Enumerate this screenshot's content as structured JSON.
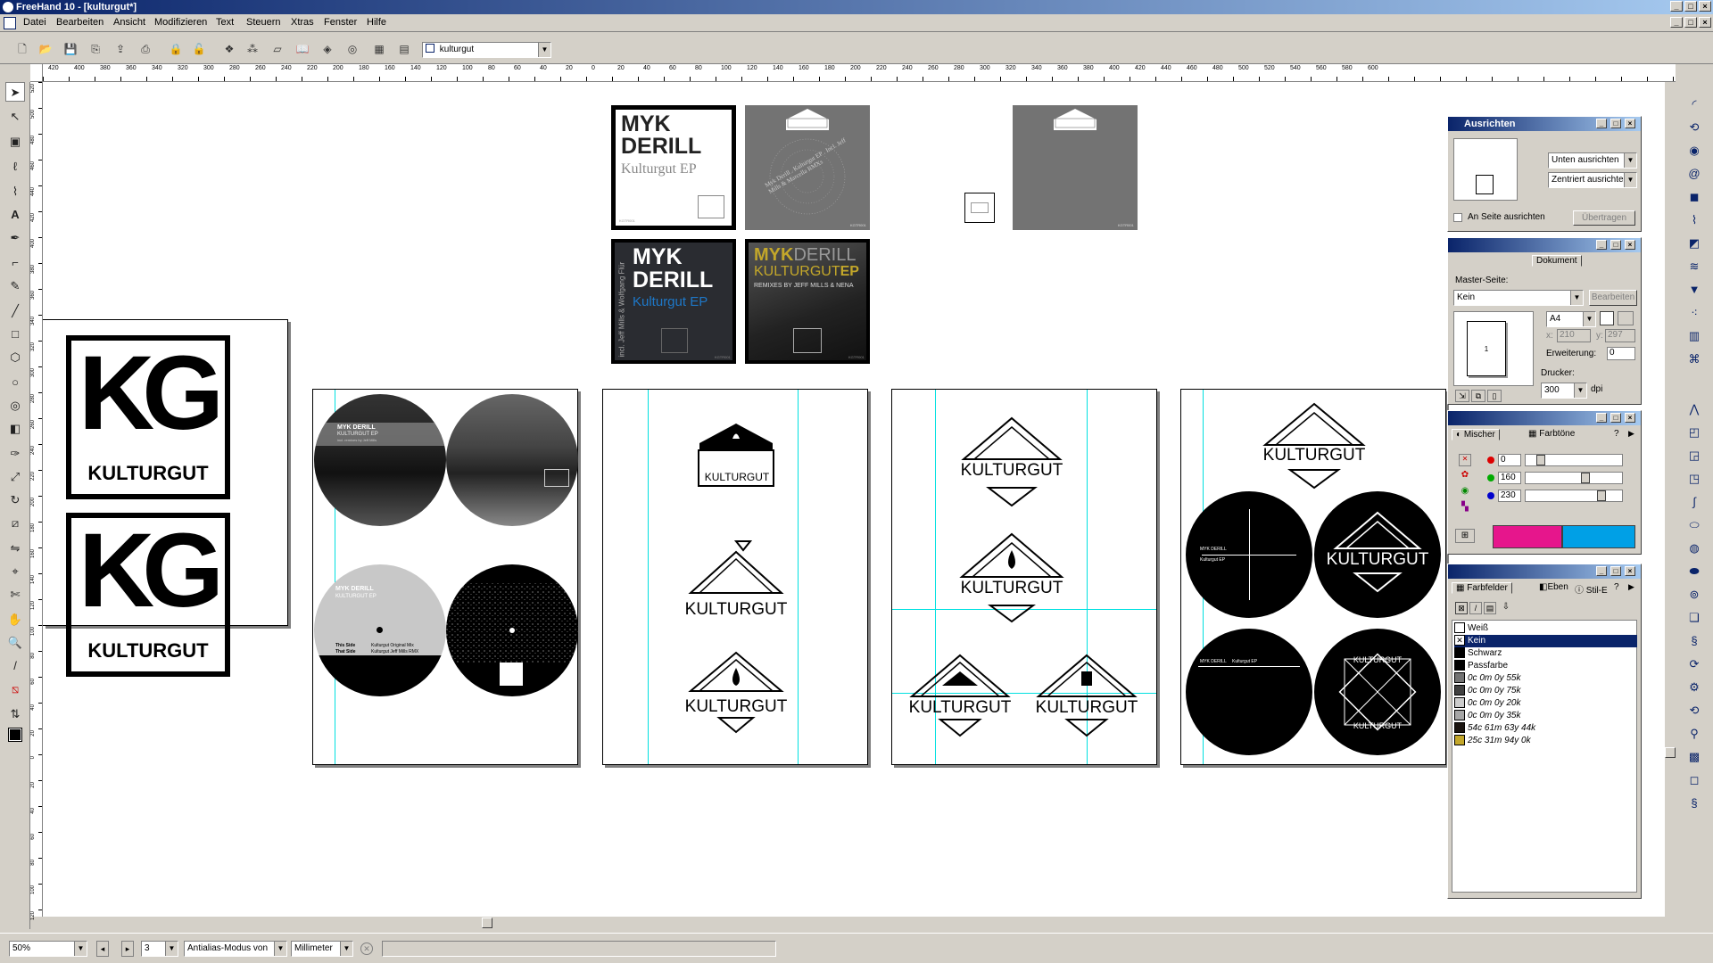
{
  "window": {
    "title": "FreeHand 10 - [kulturgut*]"
  },
  "menu": [
    "Datei",
    "Bearbeiten",
    "Ansicht",
    "Modifizieren",
    "Text",
    "Steuern",
    "Xtras",
    "Fenster",
    "Hilfe"
  ],
  "toolbar": {
    "document_select": "kulturgut"
  },
  "hruler": {
    "labels": [
      "420",
      "400",
      "380",
      "360",
      "340",
      "320",
      "300",
      "280",
      "260",
      "240",
      "220",
      "200",
      "180",
      "160",
      "140",
      "120",
      "100",
      "80",
      "60",
      "40",
      "20",
      "0",
      "20",
      "40",
      "60",
      "80",
      "100",
      "120",
      "140",
      "160",
      "180",
      "200",
      "220",
      "240",
      "260",
      "280",
      "300",
      "320",
      "340",
      "360",
      "380",
      "400",
      "420",
      "440",
      "460",
      "480",
      "500",
      "520",
      "540",
      "560",
      "580",
      "600"
    ]
  },
  "vruler": {
    "labels": [
      "520",
      "500",
      "480",
      "460",
      "440",
      "420",
      "400",
      "380",
      "360",
      "340",
      "320",
      "300",
      "280",
      "260",
      "240",
      "220",
      "200",
      "180",
      "160",
      "140",
      "120",
      "100",
      "80",
      "60",
      "40",
      "20",
      "0",
      "20",
      "40",
      "60",
      "80",
      "100",
      "120"
    ]
  },
  "artwork": {
    "cover1": {
      "line1": "MYK",
      "line2": "DERILL",
      "line3": "Kulturgut EP",
      "cat": "KGTR001"
    },
    "cover2": {
      "ring": "Myk Derill . Kulturgut EP . Incl. Jeff Mills & Marcella RMXs",
      "cat": "KGTR001"
    },
    "cover3": {
      "line1": "MYK",
      "line2": "DERILL",
      "line3": "Kulturgut EP",
      "side": "incl. Jeff Mills & Wolfgang Flür",
      "cat": "KGTR001"
    },
    "cover4": {
      "line1a": "MYK",
      "line1b": "DERILL",
      "line2a": "KULTURGUT",
      "line2b": "EP",
      "line3": "REMIXES BY JEFF MILLS & NENA",
      "cat": "KGTR001"
    },
    "small_cat": "KGTR001",
    "logo_letters": "KG",
    "brand": "KULTURGUT",
    "label1": {
      "title": "MYK DERILL",
      "sub": "KULTURGUT EP",
      "note": "incl. remixes by Jeff Mills"
    },
    "label3": {
      "title": "MYK DERILL",
      "sub": "KULTURGUT EP",
      "side_a": "This Side",
      "track_a": "Kulturgut Original Mix",
      "side_b": "That Side",
      "track_b": "Kulturgut Jeff Mills RMX"
    },
    "disc_lower": {
      "title": "MYK DERILL",
      "sub": "Kulturgut EP"
    }
  },
  "panel_align": {
    "title": "Ausrichten",
    "v_option": "Unten ausrichten",
    "h_option": "Zentriert ausrichten",
    "to_page": "An Seite ausrichten",
    "apply": "Übertragen"
  },
  "panel_doc": {
    "tab": "Dokument",
    "master_label": "Master-Seite:",
    "master_value": "Kein",
    "edit": "Bearbeiten",
    "page_size": "A4",
    "x_label": "x:",
    "x_value": "210",
    "y_label": "y:",
    "y_value": "297",
    "page_num": "1",
    "bleed_label": "Erweiterung:",
    "bleed_value": "0",
    "printer_label": "Drucker:",
    "dpi_value": "300",
    "dpi_unit": "dpi"
  },
  "panel_mixer": {
    "tab1": "Mischer",
    "tab2": "Farbtöne",
    "r": "0",
    "g": "160",
    "b": "230"
  },
  "panel_swatches": {
    "tab1": "Farbfelder",
    "tab2": "Eben",
    "tab3": "Stil-E",
    "items": [
      {
        "name": "Weiß",
        "color": "#ffffff"
      },
      {
        "name": "Kein",
        "color": "#ffffff"
      },
      {
        "name": "Schwarz",
        "color": "#000000"
      },
      {
        "name": "Passfarbe",
        "color": "#000000"
      },
      {
        "name": "0c 0m 0y 55k",
        "color": "#737373"
      },
      {
        "name": "0c 0m 0y 75k",
        "color": "#404040"
      },
      {
        "name": "0c 0m 0y 20k",
        "color": "#cccccc"
      },
      {
        "name": "0c 0m 0y 35k",
        "color": "#a6a6a6"
      },
      {
        "name": "54c 61m 63y 44k",
        "color": "#3a2a24"
      },
      {
        "name": "25c 31m 94y 0k",
        "color": "#c3a72a"
      }
    ]
  },
  "status": {
    "zoom": "50%",
    "page": "3",
    "render_mode": "Antialias-Modus von",
    "units": "Millimeter"
  },
  "colors": {
    "accent": "#0a246a",
    "guide": "#00e0e0",
    "gold": "#c3a72a",
    "cover_blue": "#1e78c8",
    "magenta": "#e6168c",
    "cyan": "#00a0e6"
  }
}
